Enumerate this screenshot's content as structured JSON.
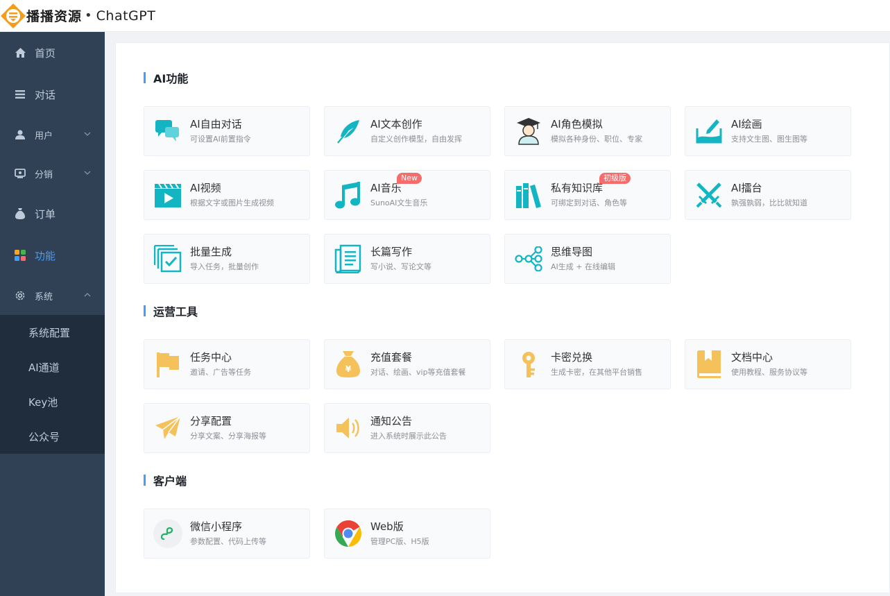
{
  "header": {
    "brand": "播播资源",
    "separator": "•",
    "product": "ChatGPT"
  },
  "sidebar": {
    "items": [
      {
        "label": "首页",
        "icon": "home-icon"
      },
      {
        "label": "对话",
        "icon": "list-icon"
      },
      {
        "label": "用户",
        "icon": "user-icon"
      },
      {
        "label": "分销",
        "icon": "distribution-icon"
      },
      {
        "label": "订单",
        "icon": "money-bag-icon"
      },
      {
        "label": "功能",
        "icon": "apps-icon"
      },
      {
        "label": "系统",
        "icon": "gear-icon"
      }
    ],
    "submenu": [
      "系统配置",
      "AI通道",
      "Key池",
      "公众号"
    ],
    "active_color": "#409eff"
  },
  "sections": [
    {
      "title": "AI功能",
      "cards": [
        {
          "title": "AI自由对话",
          "desc": "可设置AI前置指令",
          "icon": "chat-bubbles-icon"
        },
        {
          "title": "AI文本创作",
          "desc": "自定义创作模型，自由发挥",
          "icon": "feather-icon"
        },
        {
          "title": "AI角色模拟",
          "desc": "模拟各种身份、职位、专家",
          "icon": "graduate-icon"
        },
        {
          "title": "AI绘画",
          "desc": "支持文生图、图生图等",
          "icon": "paint-brush-icon"
        },
        {
          "title": "AI视频",
          "desc": "根据文字或图片生成视频",
          "icon": "video-icon"
        },
        {
          "title": "AI音乐",
          "desc": "SunoAI文生音乐",
          "icon": "music-note-icon",
          "badge": "New"
        },
        {
          "title": "私有知识库",
          "desc": "可绑定到对话、角色等",
          "icon": "books-icon",
          "badge": "初级版"
        },
        {
          "title": "AI擂台",
          "desc": "孰强孰弱，比比就知道",
          "icon": "crossed-swords-icon"
        },
        {
          "title": "批量生成",
          "desc": "导入任务，批量创作",
          "icon": "batch-check-icon"
        },
        {
          "title": "长篇写作",
          "desc": "写小说、写论文等",
          "icon": "scroll-document-icon"
        },
        {
          "title": "思维导图",
          "desc": "AI生成 + 在线编辑",
          "icon": "mind-map-icon"
        }
      ]
    },
    {
      "title": "运营工具",
      "cards": [
        {
          "title": "任务中心",
          "desc": "邀请、广告等任务",
          "icon": "flag-icon"
        },
        {
          "title": "充值套餐",
          "desc": "对话、绘画、vip等充值套餐",
          "icon": "money-bag-yen-icon"
        },
        {
          "title": "卡密兑换",
          "desc": "生成卡密，在其他平台销售",
          "icon": "key-icon"
        },
        {
          "title": "文档中心",
          "desc": "使用教程、服务协议等",
          "icon": "book-icon"
        },
        {
          "title": "分享配置",
          "desc": "分享文案、分享海报等",
          "icon": "paper-plane-icon"
        },
        {
          "title": "通知公告",
          "desc": "进入系统时展示此公告",
          "icon": "speaker-icon"
        }
      ]
    },
    {
      "title": "客户端",
      "cards": [
        {
          "title": "微信小程序",
          "desc": "参数配置、代码上传等",
          "icon": "wechat-miniprogram-icon"
        },
        {
          "title": "Web版",
          "desc": "管理PC版、H5版",
          "icon": "chrome-icon"
        }
      ]
    }
  ],
  "colors": {
    "teal": "#13b5c3",
    "amber": "#f5c15b",
    "badge": "#f56c6c",
    "accent": "#409eff"
  }
}
